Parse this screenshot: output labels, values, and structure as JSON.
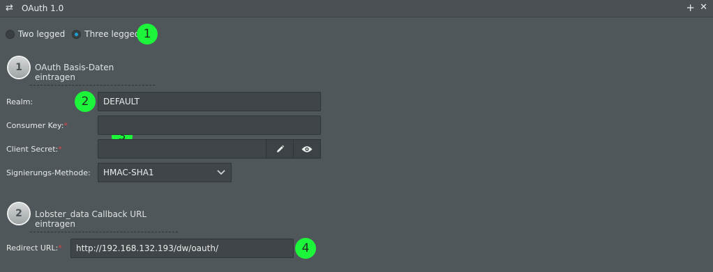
{
  "window": {
    "title": "OAuth 1.0",
    "icon": "swap-arrows-icon",
    "add_icon": "+",
    "close_icon": "✕"
  },
  "auth_mode": {
    "options": [
      {
        "label": "Two legged",
        "selected": false
      },
      {
        "label": "Three legged",
        "selected": true
      }
    ]
  },
  "annotations": [
    "1",
    "2",
    "3",
    "4"
  ],
  "section1": {
    "number": "1",
    "title": "OAuth Basis-Daten eintragen"
  },
  "form": {
    "realm_label": "Realm:",
    "realm_value": "DEFAULT",
    "consumer_key_label": "Consumer Key:",
    "consumer_key_value": "",
    "client_secret_label": "Client Secret:",
    "client_secret_value": "",
    "signing_method_label": "Signierungs-Methode:",
    "signing_method_value": "HMAC-SHA1",
    "required_mark": "*"
  },
  "section2": {
    "number": "2",
    "title": "Lobster_data Callback URL eintragen"
  },
  "callback": {
    "redirect_label": "Redirect URL:",
    "redirect_value": "http://192.168.132.193/dw/oauth/"
  },
  "colors": {
    "background": "#50575a",
    "marker": "#1df53b",
    "radio_selected": "#1b9fd6",
    "required": "#e04545"
  }
}
